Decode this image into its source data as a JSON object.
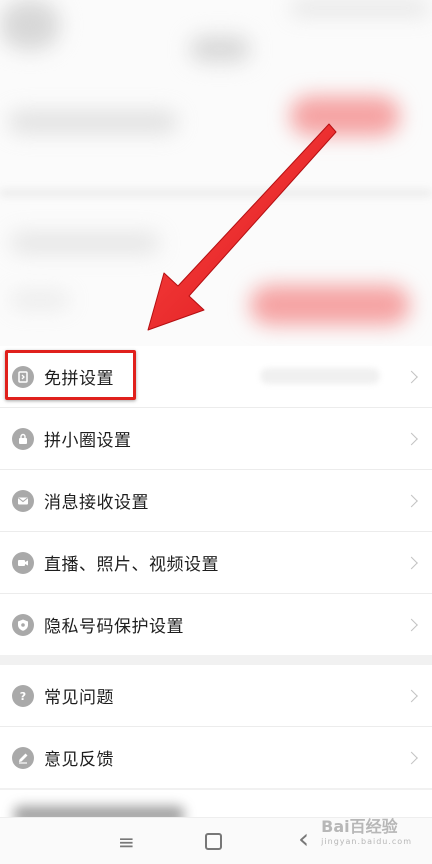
{
  "settings": {
    "items": [
      {
        "label": "免拼设置",
        "icon": "shop-icon"
      },
      {
        "label": "拼小圈设置",
        "icon": "lock-icon"
      },
      {
        "label": "消息接收设置",
        "icon": "mail-icon"
      },
      {
        "label": "直播、照片、视频设置",
        "icon": "video-icon"
      },
      {
        "label": "隐私号码保护设置",
        "icon": "shield-phone-icon"
      }
    ],
    "items2": [
      {
        "label": "常见问题",
        "icon": "question-icon"
      },
      {
        "label": "意见反馈",
        "icon": "pencil-icon"
      }
    ]
  },
  "navbar": {
    "menu_icon": "≡",
    "back_icon": "‹"
  },
  "watermark": {
    "text": "Bai百经验",
    "sub": "jingyan.baidu.com"
  },
  "colors": {
    "highlight": "#e0201c",
    "icon_gray": "#a9a9a9"
  }
}
